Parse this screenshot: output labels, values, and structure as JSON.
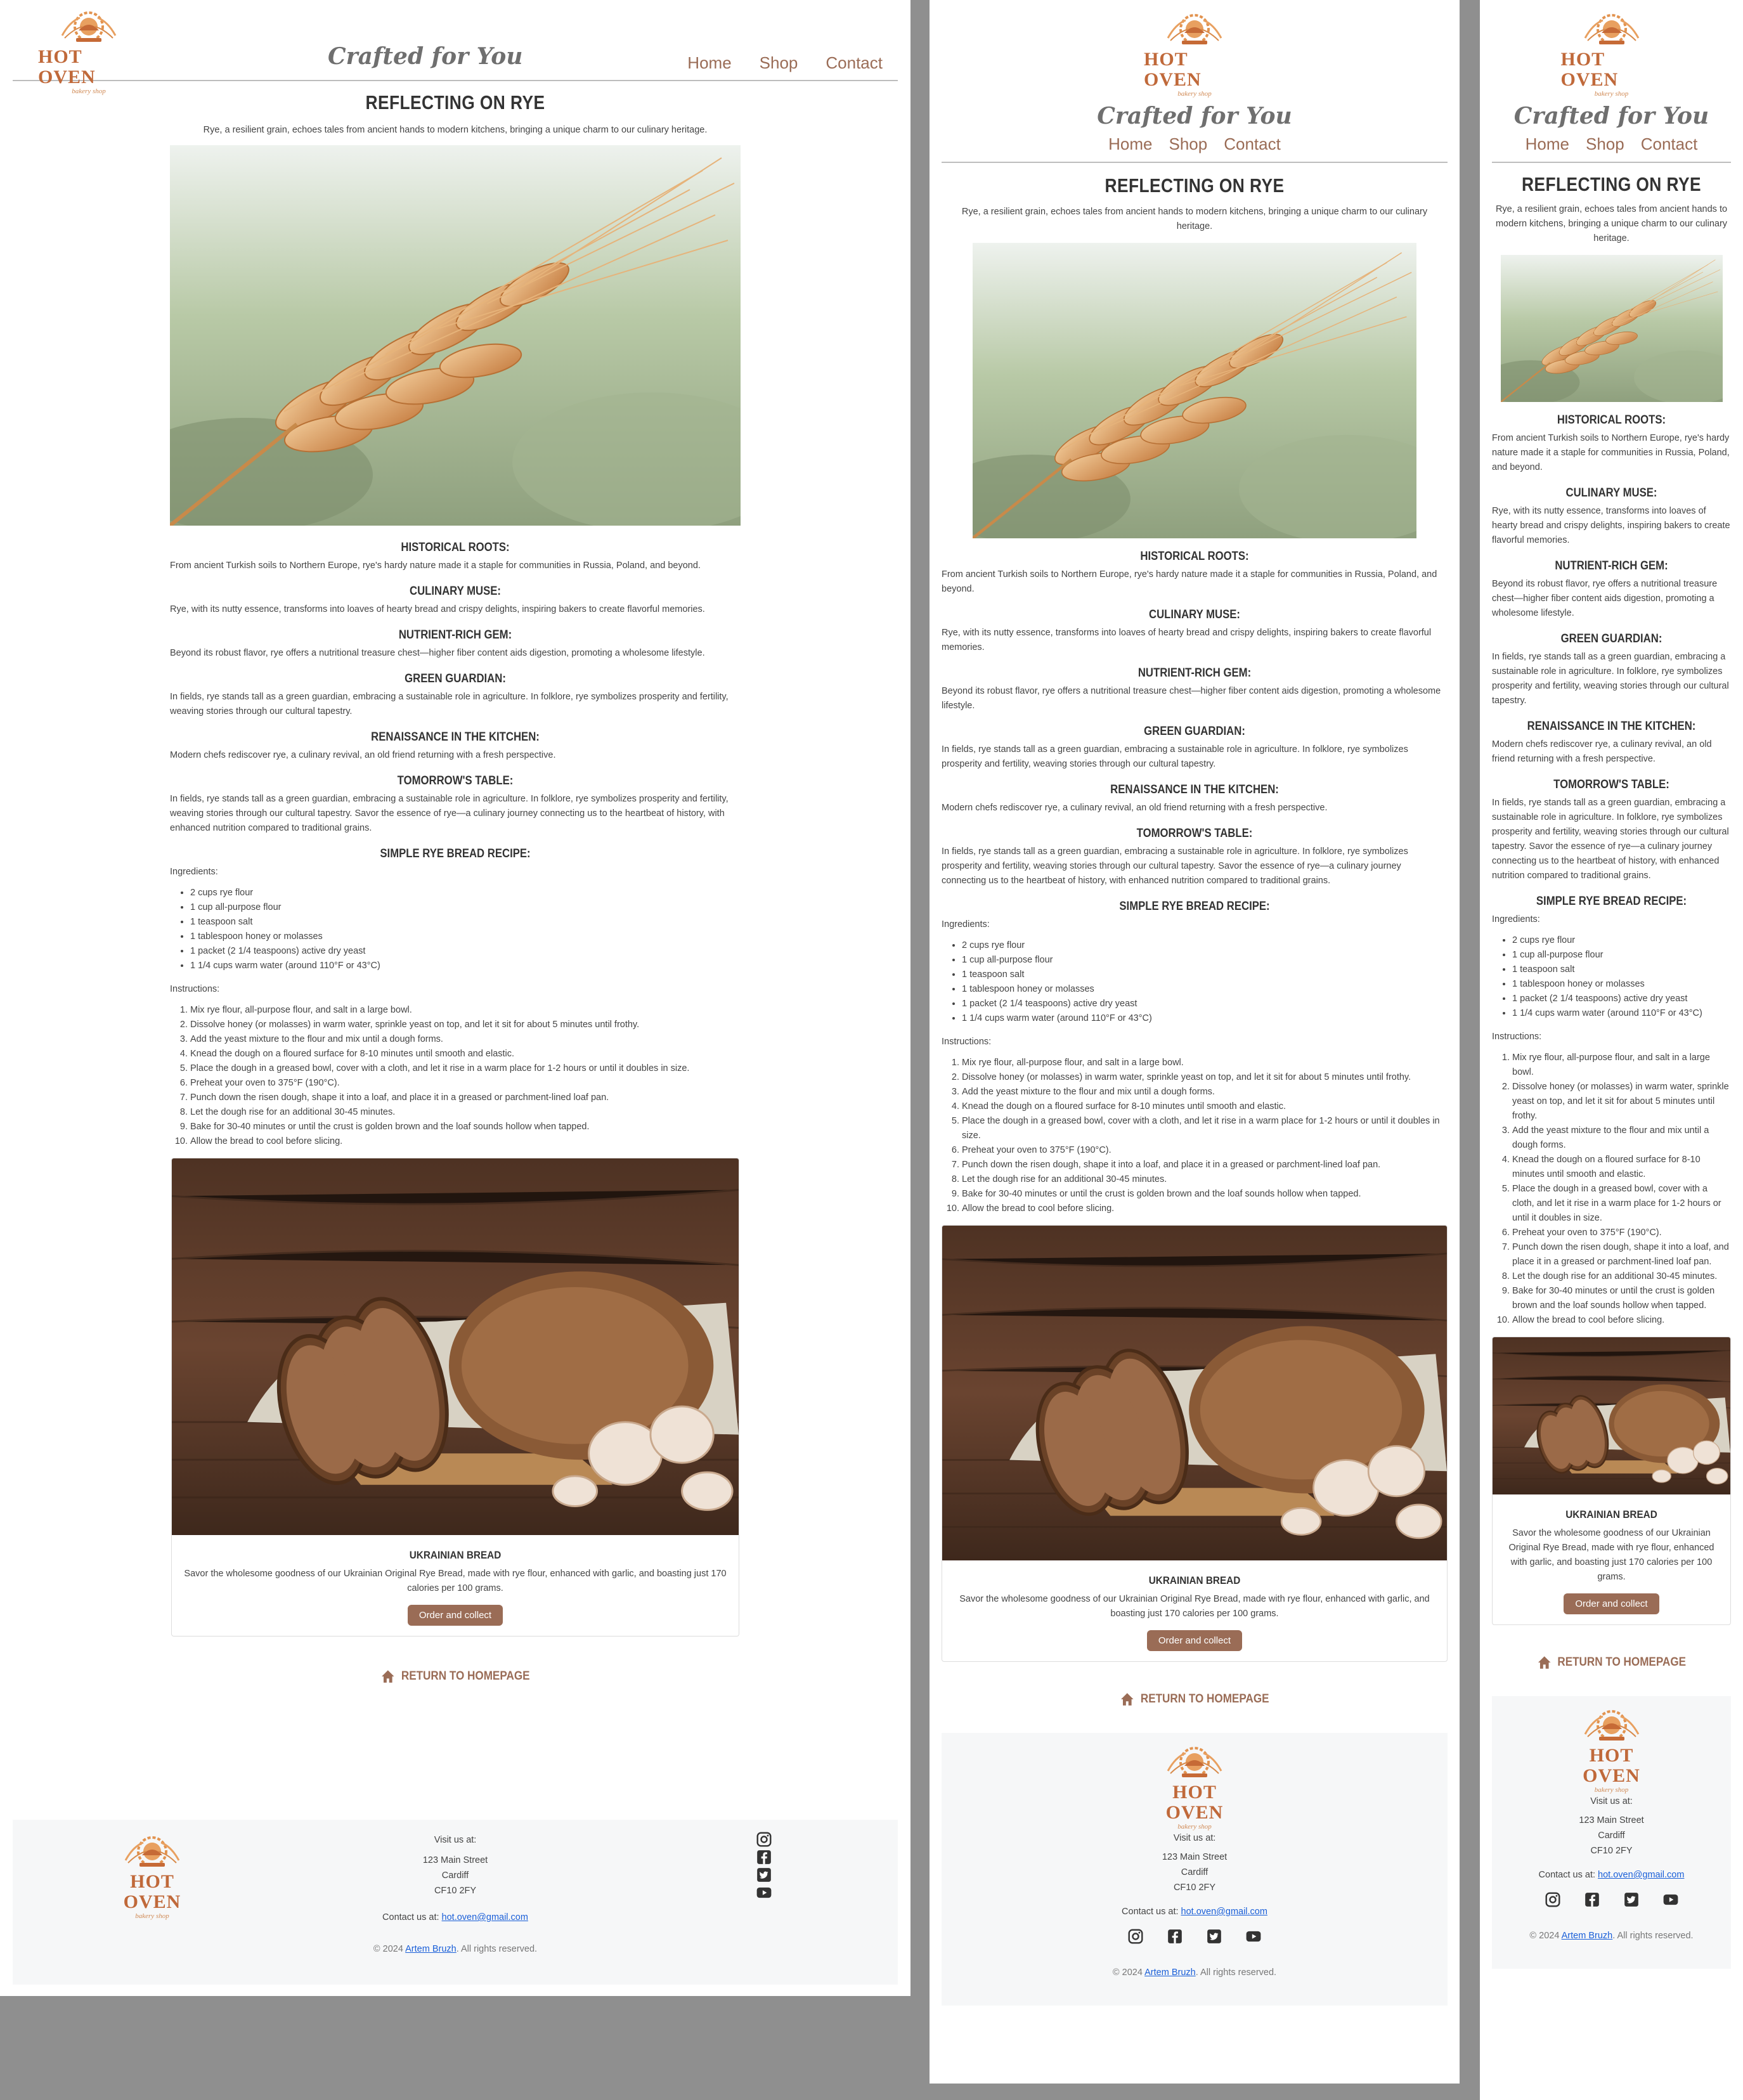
{
  "header": {
    "brand": "HOT OVEN",
    "brand_sub": "bakery shop",
    "tagline": "Crafted for You",
    "nav": [
      "Home",
      "Shop",
      "Contact"
    ]
  },
  "title": "REFLECTING ON RYE",
  "intro": "Rye, a resilient grain, echoes tales from ancient hands to modern kitchens, bringing a unique charm to our culinary heritage.",
  "sections": [
    {
      "heading": "HISTORICAL ROOTS:",
      "text": "From ancient Turkish soils to Northern Europe, rye's hardy nature made it a staple for communities in Russia, Poland, and beyond."
    },
    {
      "heading": "CULINARY MUSE:",
      "text": "Rye, with its nutty essence, transforms into loaves of hearty bread and crispy delights, inspiring bakers to create flavorful memories."
    },
    {
      "heading": "NUTRIENT-RICH GEM:",
      "text": "Beyond its robust flavor, rye offers a nutritional treasure chest—higher fiber content aids digestion, promoting a wholesome lifestyle."
    },
    {
      "heading": "GREEN GUARDIAN:",
      "text": "In fields, rye stands tall as a green guardian, embracing a sustainable role in agriculture. In folklore, rye symbolizes prosperity and fertility, weaving stories through our cultural tapestry."
    },
    {
      "heading": "RENAISSANCE IN THE KITCHEN:",
      "text": "Modern chefs rediscover rye, a culinary revival, an old friend returning with a fresh perspective."
    },
    {
      "heading": "TOMORROW'S TABLE:",
      "text": "In fields, rye stands tall as a green guardian, embracing a sustainable role in agriculture. In folklore, rye symbolizes prosperity and fertility, weaving stories through our cultural tapestry. Savor the essence of rye—a culinary journey connecting us to the heartbeat of history, with enhanced nutrition compared to traditional grains."
    }
  ],
  "recipe": {
    "heading": "SIMPLE RYE BREAD RECIPE:",
    "ingredients_label": "Ingredients:",
    "ingredients": [
      "2 cups rye flour",
      "1 cup all-purpose flour",
      "1 teaspoon salt",
      "1 tablespoon honey or molasses",
      "1 packet (2 1/4 teaspoons) active dry yeast",
      "1 1/4 cups warm water (around 110°F or 43°C)"
    ],
    "instructions_label": "Instructions:",
    "instructions": [
      "Mix rye flour, all-purpose flour, and salt in a large bowl.",
      "Dissolve honey (or molasses) in warm water, sprinkle yeast on top, and let it sit for about 5 minutes until frothy.",
      "Add the yeast mixture to the flour and mix until a dough forms.",
      "Knead the dough on a floured surface for 8-10 minutes until smooth and elastic.",
      "Place the dough in a greased bowl, cover with a cloth, and let it rise in a warm place for 1-2 hours or until it doubles in size.",
      "Preheat your oven to 375°F (190°C).",
      "Punch down the risen dough, shape it into a loaf, and place it in a greased or parchment-lined loaf pan.",
      "Let the dough rise for an additional 30-45 minutes.",
      "Bake for 30-40 minutes or until the crust is golden brown and the loaf sounds hollow when tapped.",
      "Allow the bread to cool before slicing."
    ]
  },
  "product": {
    "title": "UKRAINIAN BREAD",
    "desc": "Savor the wholesome goodness of our Ukrainian Original Rye Bread, made with rye flour, enhanced with garlic, and boasting just 170 calories per 100 grams.",
    "button": "Order and collect"
  },
  "return_link": "RETURN TO HOMEPAGE",
  "footer": {
    "visit": "Visit us at:",
    "address": [
      "123 Main Street",
      "Cardiff",
      "CF10 2FY"
    ],
    "contact_prefix": "Contact us at:",
    "email": "hot.oven@gmail.com",
    "copy_prefix": "© 2024",
    "author": "Artem Bruzh",
    "copy_suffix": ". All rights reserved.",
    "social": [
      "instagram-icon",
      "facebook-icon",
      "twitter-icon",
      "youtube-icon"
    ]
  }
}
